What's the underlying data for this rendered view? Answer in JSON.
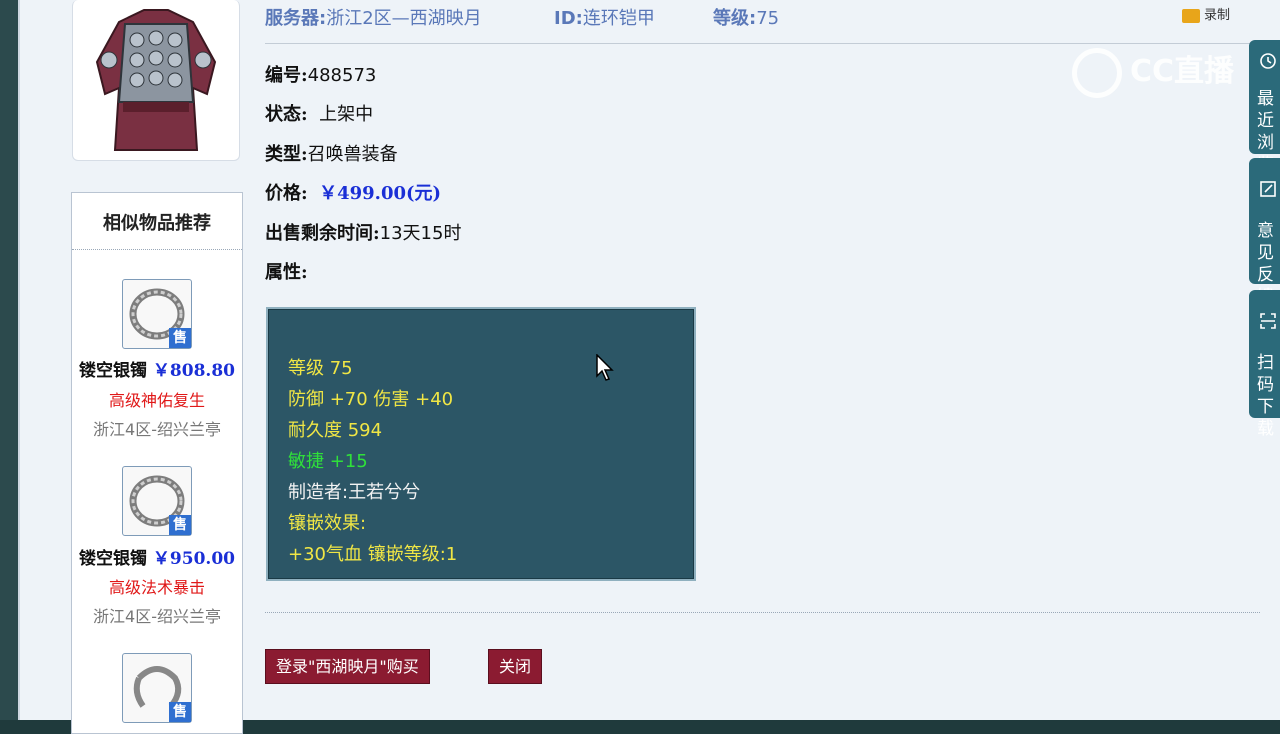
{
  "header": {
    "server_label": "服务器:",
    "server_value": "浙江2区—西湖映月",
    "id_label": "ID:",
    "id_value": "连环铠甲",
    "level_label": "等级:",
    "level_value": "75",
    "top_badge": "录制"
  },
  "item": {
    "number_label": "编号:",
    "number_value": "488573",
    "status_label": "状态:",
    "status_value": "上架中",
    "type_label": "类型:",
    "type_value": "召唤兽装备",
    "price_label": "价格:",
    "price_value": "￥499.00(元)",
    "time_label": "出售剩余时间:",
    "time_value": "13天15时",
    "attr_label": "属性:"
  },
  "attributes": [
    {
      "text": "等级 75",
      "color": "#f0e645"
    },
    {
      "text": "防御 +70 伤害 +40",
      "color": "#f0e645"
    },
    {
      "text": "耐久度 594",
      "color": "#f0e645"
    },
    {
      "text": "敏捷 +15",
      "color": "#2fe03a"
    },
    {
      "text": "制造者:王若兮兮",
      "color": "#f2f2f2"
    },
    {
      "text": "镶嵌效果:",
      "color": "#f0e645"
    },
    {
      "text": "+30气血 镶嵌等级:1",
      "color": "#f0e645"
    }
  ],
  "similar": {
    "title": "相似物品推荐",
    "sold_badge": "售",
    "items": [
      {
        "name": "镂空银镯",
        "price": "￥808.80",
        "attr": "高级神佑复生",
        "server": "浙江4区-绍兴兰亭"
      },
      {
        "name": "镂空银镯",
        "price": "￥950.00",
        "attr": "高级法术暴击",
        "server": "浙江4区-绍兴兰亭"
      },
      {
        "name": "",
        "price": "",
        "attr": "",
        "server": ""
      }
    ]
  },
  "buttons": {
    "login_buy": "登录\"西湖映月\"购买",
    "close": "关闭"
  },
  "sidebar": {
    "recent": "最近浏览",
    "feedback": "意见反馈",
    "scan": "扫码下载"
  },
  "watermark": "CC直播"
}
